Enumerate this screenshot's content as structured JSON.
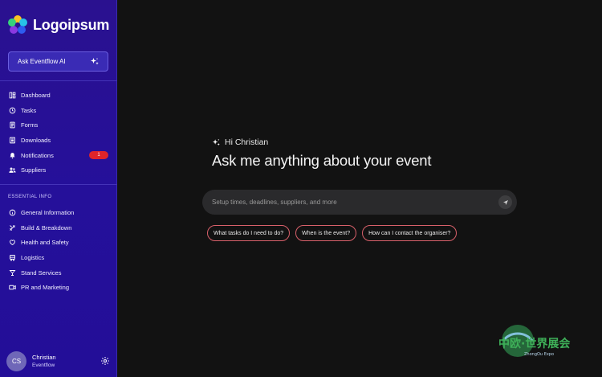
{
  "brand": {
    "name": "Logoipsum"
  },
  "ask_button": {
    "label": "Ask Eventflow AI",
    "icon": "sparkle-icon"
  },
  "nav": [
    {
      "label": "Dashboard",
      "icon": "dashboard-icon"
    },
    {
      "label": "Tasks",
      "icon": "clock-icon"
    },
    {
      "label": "Forms",
      "icon": "forms-icon"
    },
    {
      "label": "Downloads",
      "icon": "downloads-icon"
    },
    {
      "label": "Notifications",
      "icon": "bell-icon",
      "badge": "1"
    },
    {
      "label": "Suppliers",
      "icon": "users-icon"
    }
  ],
  "essential": {
    "title": "ESSENTIAL INFO",
    "items": [
      {
        "label": "General Information",
        "icon": "info-icon"
      },
      {
        "label": "Build & Breakdown",
        "icon": "tools-icon"
      },
      {
        "label": "Health and Safety",
        "icon": "heart-icon"
      },
      {
        "label": "Logistics",
        "icon": "truck-icon"
      },
      {
        "label": "Stand Services",
        "icon": "cocktail-icon"
      },
      {
        "label": "PR and Marketing",
        "icon": "video-icon"
      }
    ]
  },
  "profile": {
    "initials": "CS",
    "name": "Christian",
    "org": "Eventflow"
  },
  "main": {
    "greeting": "Hi Christian",
    "headline": "Ask me anything about your event",
    "prompt_placeholder": "Setup times, deadlines, suppliers, and more",
    "suggestions": [
      "What tasks do I need to do?",
      "When is the event?",
      "How can I contact the organiser?"
    ]
  },
  "watermark": {
    "text": "中欧·世界展会",
    "sub": "ZhongOu Expo"
  },
  "colors": {
    "sidebar": "#2a118f",
    "main_bg": "#121212",
    "badge": "#e0242a",
    "chip_border": "#d8606a"
  }
}
